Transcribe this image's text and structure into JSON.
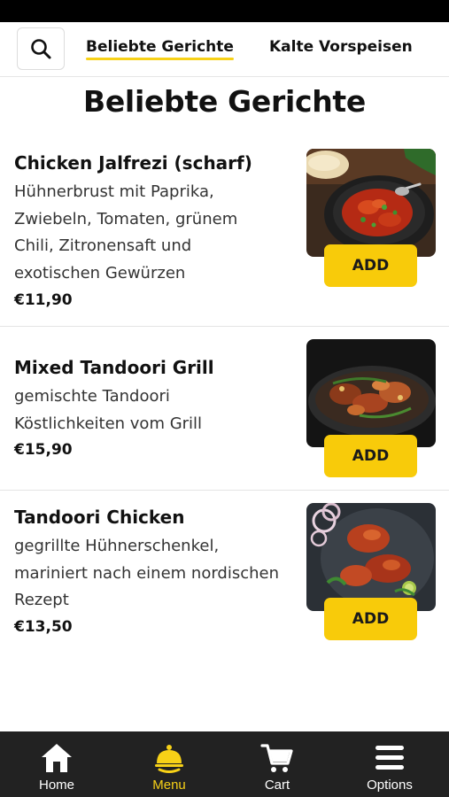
{
  "tabs": {
    "search_icon": "search-icon",
    "items": [
      {
        "label": "Beliebte Gerichte"
      },
      {
        "label": "Kalte Vorspeisen"
      }
    ]
  },
  "page": {
    "title": "Beliebte Gerichte"
  },
  "dishes": [
    {
      "name": "Chicken Jalfrezi (scharf)",
      "description": "Hühnerbrust mit Paprika, Zwiebeln, Tomaten, grünem Chili, Zitronensaft und exotischen Gewürzen",
      "price": "€11,90",
      "add_label": "ADD"
    },
    {
      "name": "Mixed Tandoori Grill",
      "description": "gemischte Tandoori Köstlichkeiten vom Grill",
      "price": "€15,90",
      "add_label": "ADD"
    },
    {
      "name": "Tandoori Chicken",
      "description": "gegrillte Hühnerschenkel, mariniert nach einem nordischen Rezept",
      "price": "€13,50",
      "add_label": "ADD"
    }
  ],
  "bottom_nav": {
    "items": [
      {
        "label": "Home",
        "icon": "home-icon"
      },
      {
        "label": "Menu",
        "icon": "cloche-icon",
        "active": true
      },
      {
        "label": "Cart",
        "icon": "cart-icon"
      },
      {
        "label": "Options",
        "icon": "menu-icon"
      }
    ]
  },
  "colors": {
    "accent": "#f7d117",
    "add_button": "#f8cb0a",
    "nav_background": "#222222"
  }
}
